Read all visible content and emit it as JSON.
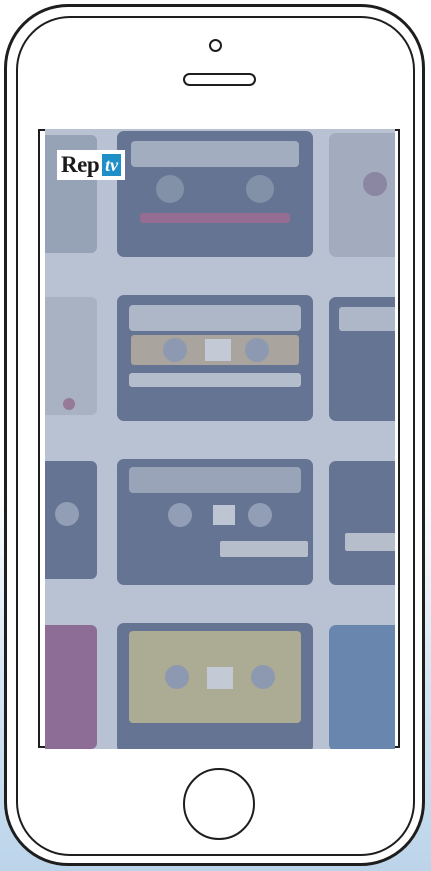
{
  "device": {
    "type": "phone",
    "frame_color": "#1e1e1e"
  },
  "screen": {
    "background_image": "cassette-tapes-grid",
    "overlay_color": "#b6c1d2",
    "logo": {
      "brand": "Rep",
      "badge": "tv",
      "badge_color": "#1f8fc7"
    }
  },
  "icons": {
    "camera": "camera-icon",
    "speaker": "speaker-icon",
    "home": "home-button-icon"
  }
}
